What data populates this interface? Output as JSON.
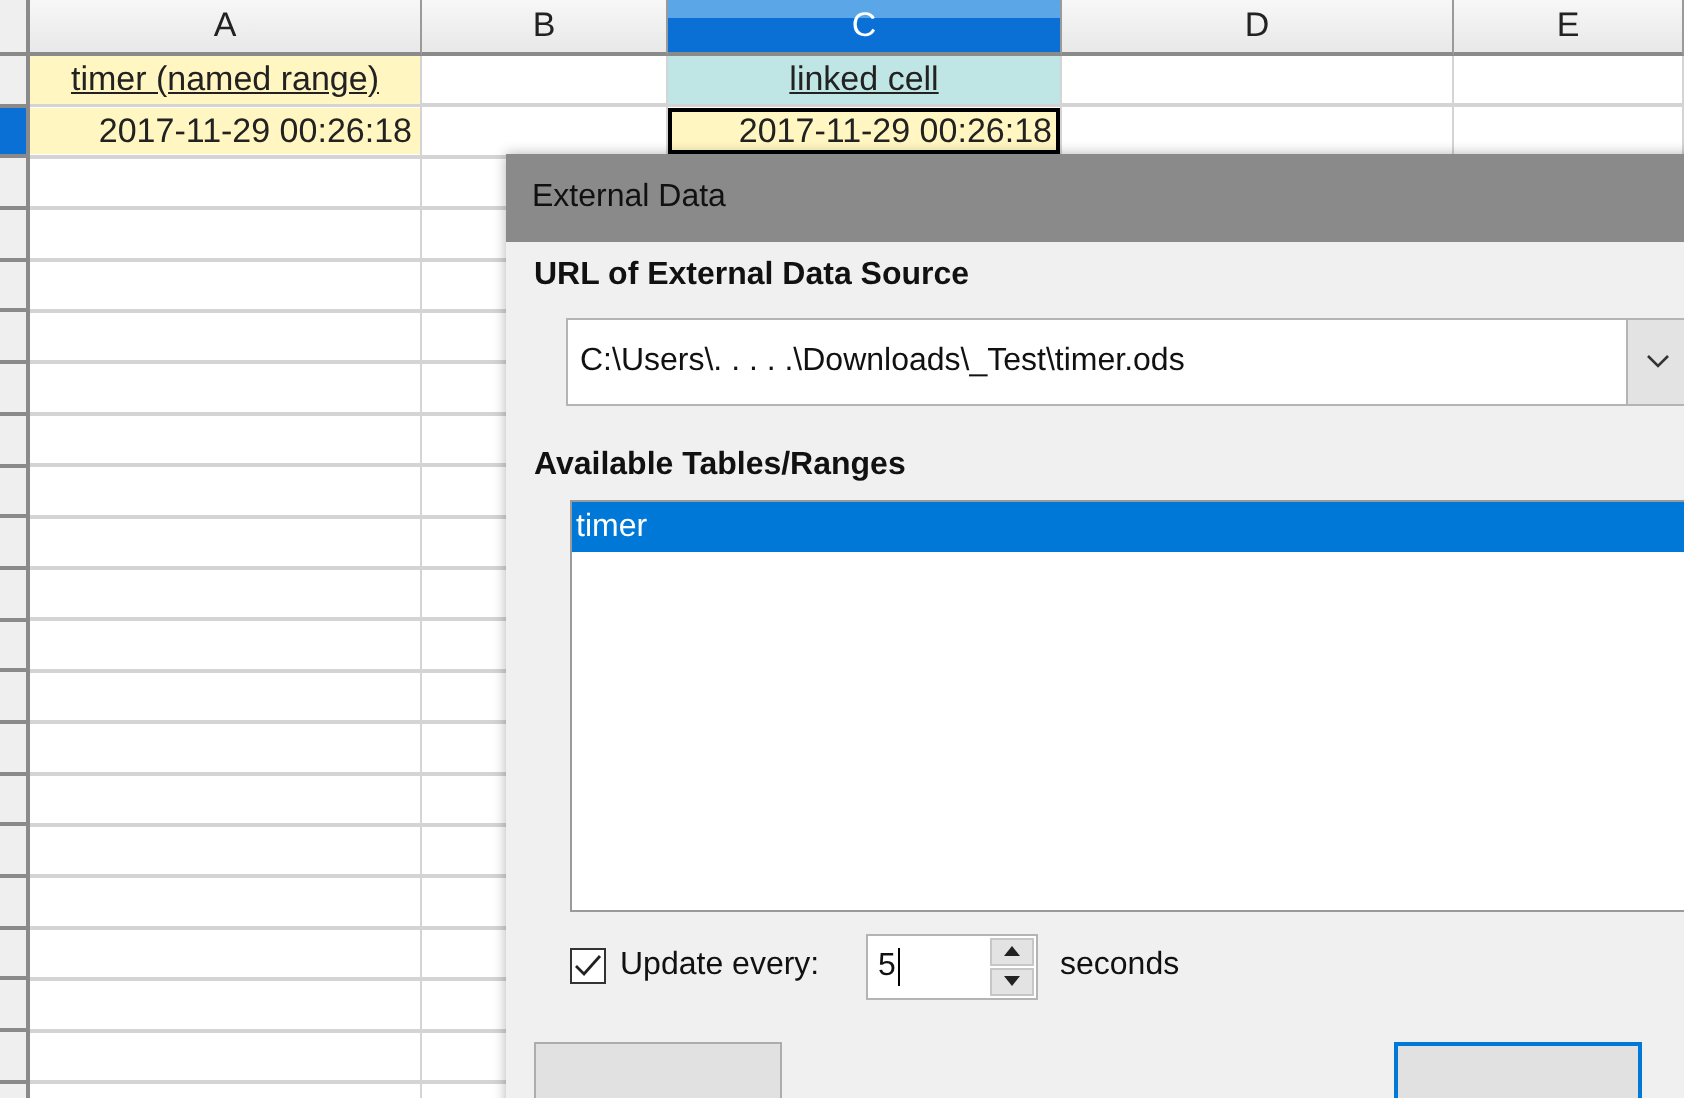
{
  "spreadsheet": {
    "columns": [
      {
        "label": "A",
        "selected": false
      },
      {
        "label": "B",
        "selected": false
      },
      {
        "label": "C",
        "selected": true
      },
      {
        "label": "D",
        "selected": false
      },
      {
        "label": "E",
        "selected": false
      }
    ],
    "rows": [
      {
        "selected": false,
        "cells": [
          {
            "text": "timer (named range)",
            "color": "#fff6c1",
            "kind": "heading",
            "active": false
          },
          null,
          {
            "text": "linked cell",
            "color": "#bfe6e4",
            "kind": "heading",
            "active": false
          },
          null,
          null
        ]
      },
      {
        "selected": true,
        "cells": [
          {
            "text": "2017-11-29 00:26:18",
            "color": "#fff6c1",
            "kind": "value",
            "active": false
          },
          null,
          {
            "text": "2017-11-29 00:26:18",
            "color": "#fff6c1",
            "kind": "value",
            "active": true
          },
          null,
          null
        ]
      }
    ]
  },
  "dialog": {
    "title": "External Data",
    "url_label": "URL of External Data Source",
    "url": "C:\\Users\\. . . . .\\Downloads\\_Test\\timer.ods",
    "ranges_label": "Available Tables/Ranges",
    "ranges": [
      {
        "label": "timer",
        "selected": true
      }
    ],
    "update": {
      "checked": true,
      "label": "Update every:",
      "value": "5",
      "unit": "seconds"
    }
  }
}
